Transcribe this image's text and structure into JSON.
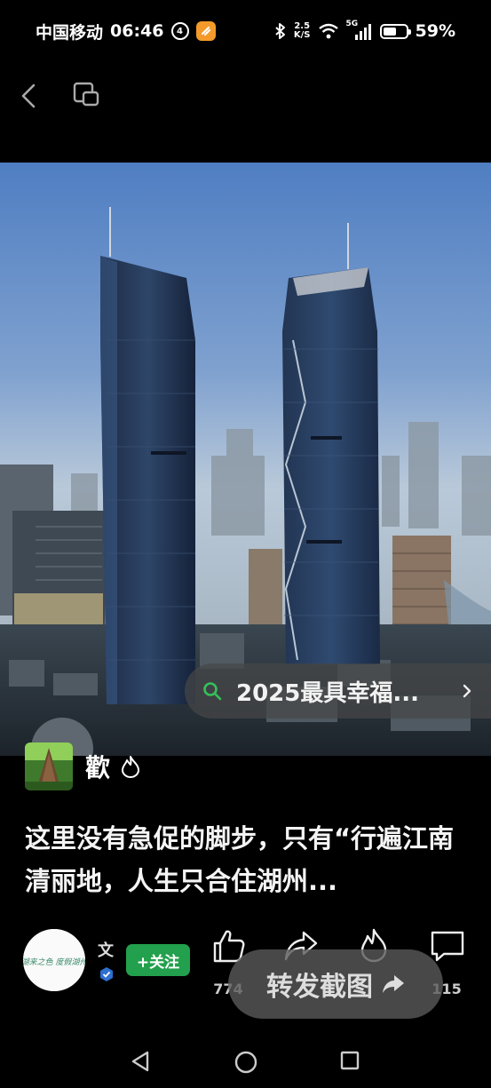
{
  "status_bar": {
    "carrier": "中国移动",
    "time": "06:46",
    "badge_text": "4",
    "net_speed_value": "2.5",
    "net_speed_unit": "K/S",
    "signal_label": "5G",
    "battery_percent": "59%",
    "battery_level": 0.59
  },
  "search": {
    "text": "2025最具幸福..."
  },
  "author": {
    "name": "歡"
  },
  "caption": {
    "text": "这里没有急促的脚步，只有“行遍江南清丽地，人生只合住湖州..."
  },
  "account": {
    "name": "文",
    "logo_text": "湖来之色 度假湖州"
  },
  "actions": {
    "follow_label": "+关注",
    "like_count": "774",
    "share_count": "",
    "fire_count": "",
    "comment_count": "115"
  },
  "toast": {
    "label": "转发截图"
  },
  "colors": {
    "follow_green": "#23a04d",
    "background": "#000000"
  }
}
